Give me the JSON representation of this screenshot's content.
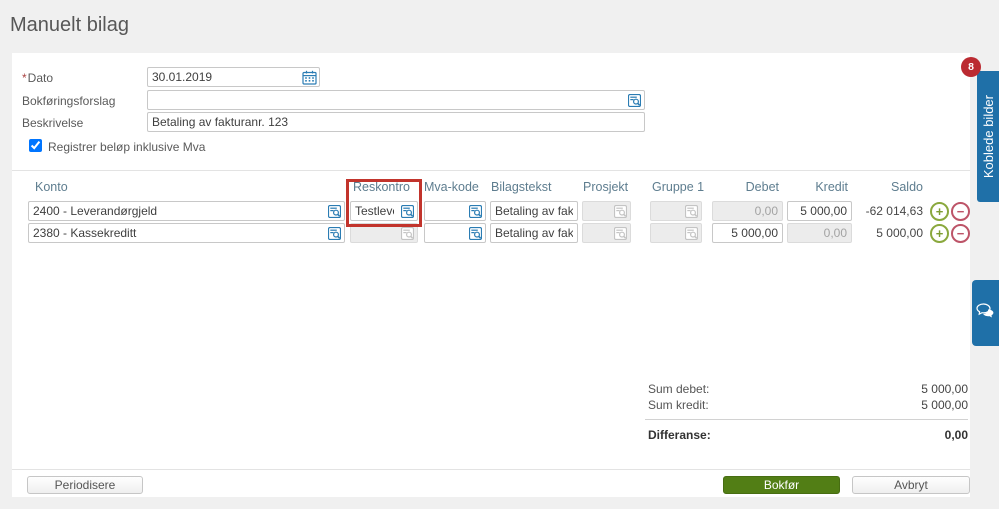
{
  "page": {
    "title": "Manuelt bilag"
  },
  "form": {
    "dato": {
      "required_mark": "*",
      "label": "Dato",
      "value": "30.01.2019"
    },
    "bokforingsforslag": {
      "label": "Bokføringsforslag",
      "value": ""
    },
    "beskrivelse": {
      "label": "Beskrivelse",
      "value": "Betaling av fakturanr. 123"
    },
    "mva_checkbox": {
      "label": "Registrer beløp inklusive Mva",
      "checked": "checked"
    }
  },
  "table": {
    "headers": {
      "konto": "Konto",
      "reskontro": "Reskontro",
      "mvakode": "Mva-kode",
      "bilagstekst": "Bilagstekst",
      "prosjekt": "Prosjekt",
      "gruppe1": "Gruppe 1",
      "debet": "Debet",
      "kredit": "Kredit",
      "saldo": "Saldo"
    },
    "rows": [
      {
        "konto": "2400 - Leverandørgjeld",
        "reskontro": "Testleve",
        "mvakode": "",
        "bilagstekst": "Betaling av faktur",
        "prosjekt": "",
        "gruppe1": "",
        "debet": "0,00",
        "kredit": "5 000,00",
        "saldo": "-62 014,63"
      },
      {
        "konto": "2380 - Kassekreditt",
        "reskontro": "",
        "mvakode": "",
        "bilagstekst": "Betaling av faktur",
        "prosjekt": "",
        "gruppe1": "",
        "debet": "5 000,00",
        "kredit": "0,00",
        "saldo": "5 000,00"
      }
    ]
  },
  "summary": {
    "sum_debet_label": "Sum debet:",
    "sum_debet": "5 000,00",
    "sum_kredit_label": "Sum kredit:",
    "sum_kredit": "5 000,00",
    "differanse_label": "Differanse:",
    "differanse": "0,00"
  },
  "footer": {
    "periodisere_label": "Periodisere",
    "bokfor_label": "Bokfør",
    "avbryt_label": "Avbryt"
  },
  "side_panel": {
    "koblede_bilder_label": "Koblede bilder",
    "badge_count": "8"
  },
  "icons": {
    "date_picker": "calendar-icon",
    "lookup": "lookup-icon",
    "add_row": "plus-icon",
    "remove_row": "minus-icon",
    "chat": "chat-bubbles-icon"
  },
  "colors": {
    "accent_blue": "#2a7cb3",
    "tab_blue": "#1f70a8",
    "badge_red": "#bb2a31",
    "highlight_red": "#c2342c",
    "button_green": "#527e15",
    "plus_green": "#8aa83d",
    "minus_red": "#bd5468",
    "header_bluegray": "#5e7d8f"
  }
}
